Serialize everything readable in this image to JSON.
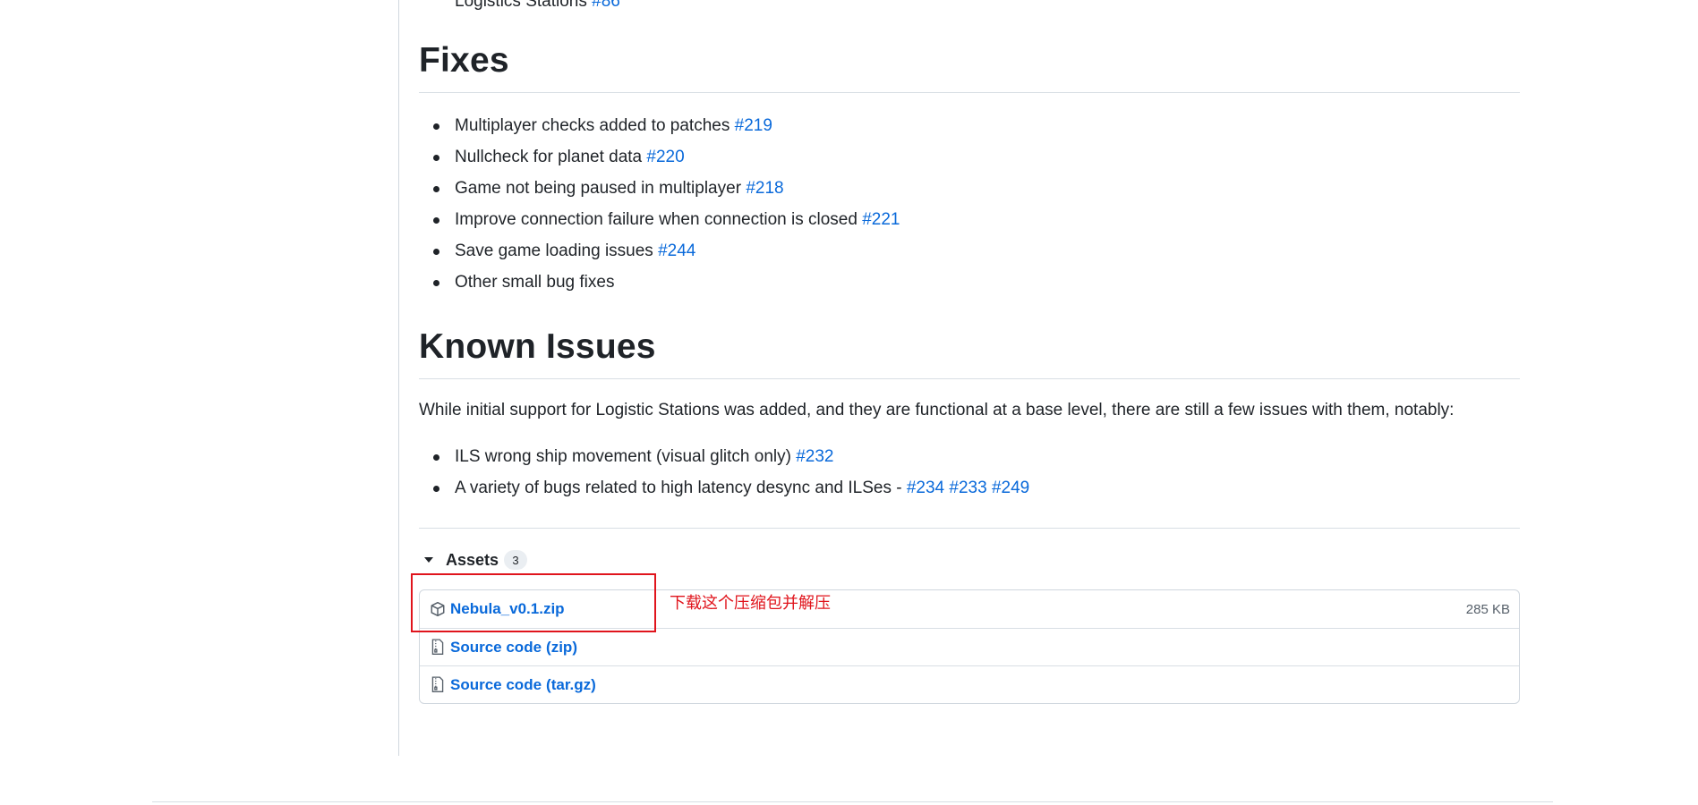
{
  "truncated_item": {
    "text": "Logistics Stations",
    "ref": "#86"
  },
  "fixes": {
    "heading": "Fixes",
    "items": [
      {
        "text": "Multiplayer checks added to patches",
        "ref": "#219"
      },
      {
        "text": "Nullcheck for planet data",
        "ref": "#220"
      },
      {
        "text": "Game not being paused in multiplayer",
        "ref": "#218"
      },
      {
        "text": "Improve connection failure when connection is closed",
        "ref": "#221"
      },
      {
        "text": "Save game loading issues",
        "ref": "#244"
      },
      {
        "text": "Other small bug fixes",
        "ref": ""
      }
    ]
  },
  "known_issues": {
    "heading": "Known Issues",
    "intro": "While initial support for Logistic Stations was added, and they are functional at a base level, there are still a few issues with them, notably:",
    "item1": {
      "text": "ILS wrong ship movement (visual glitch only)",
      "ref": "#232"
    },
    "item2": {
      "text": "A variety of bugs related to high latency desync and ILSes -",
      "refs": [
        "#234",
        "#233",
        "#249"
      ]
    }
  },
  "assets": {
    "label": "Assets",
    "count": "3",
    "items": [
      {
        "name": "Nebula_v0.1.zip",
        "suffix": "",
        "size": "285 KB",
        "icon": "package-icon"
      },
      {
        "name": "Source code",
        "suffix": "(zip)",
        "size": "",
        "icon": "file-zip-icon"
      },
      {
        "name": "Source code",
        "suffix": "(tar.gz)",
        "size": "",
        "icon": "file-zip-icon"
      }
    ]
  },
  "annotation": {
    "text": "下载这个压缩包并解压",
    "color": "#e0141c"
  },
  "colors": {
    "link": "#0969da",
    "text": "#1f2328",
    "muted": "#57606a",
    "border": "#d0d7de"
  }
}
